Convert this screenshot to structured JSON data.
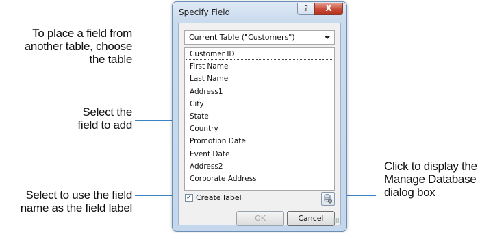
{
  "callouts": {
    "table_choice": [
      "To place a field from",
      "another table, choose",
      "the table"
    ],
    "select_field": [
      "Select the",
      "field to add"
    ],
    "create_label": [
      "Select to use the field",
      "name as the field label"
    ],
    "manage_database": [
      "Click to display the",
      "Manage Database",
      "dialog box"
    ]
  },
  "dialog": {
    "title": "Specify Field",
    "help_glyph": "?",
    "close_glyph": "X",
    "table_combo": {
      "value": "Current Table (\"Customers\")"
    },
    "fields": [
      "Customer ID",
      "First Name",
      "Last Name",
      "Address1",
      "City",
      "State",
      "Country",
      "Promotion Date",
      "Event Date",
      "Address2",
      "Corporate Address"
    ],
    "create_label": {
      "label": "Create label",
      "checked": true,
      "check_glyph": "✓"
    },
    "ok_label": "OK",
    "cancel_label": "Cancel"
  },
  "colors": {
    "leader": "#3a82c4",
    "title_bar": "#c9dbee",
    "close_button": "#c74a37"
  },
  "icons": {
    "manage_database": "database-gear-icon",
    "dropdown": "chevron-down-icon"
  }
}
